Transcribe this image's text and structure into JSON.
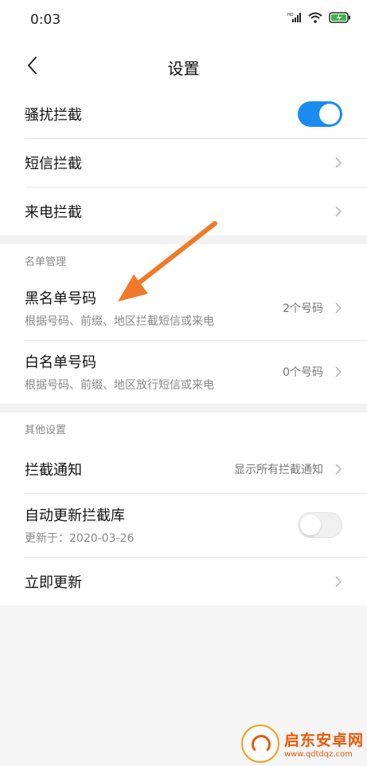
{
  "status_bar": {
    "time": "0:03"
  },
  "header": {
    "title": "设置"
  },
  "interception": {
    "items": [
      {
        "label": "骚扰拦截",
        "toggle": true
      },
      {
        "label": "短信拦截"
      },
      {
        "label": "来电拦截"
      }
    ]
  },
  "list_management": {
    "header": "名单管理",
    "items": [
      {
        "label": "黑名单号码",
        "sub": "根据号码、前缀、地区拦截短信或来电",
        "value": "2个号码"
      },
      {
        "label": "白名单号码",
        "sub": "根据号码、前缀、地区放行短信或来电",
        "value": "0个号码"
      }
    ]
  },
  "other_settings": {
    "header": "其他设置",
    "items": [
      {
        "label": "拦截通知",
        "value": "显示所有拦截通知"
      },
      {
        "label": "自动更新拦截库",
        "sub": "更新于：2020-03-26",
        "toggle": false
      },
      {
        "label": "立即更新"
      }
    ]
  },
  "watermark": {
    "title": "启东安卓网",
    "url": "www.qdtdqz.com"
  },
  "colors": {
    "accent": "#1a8cf0",
    "annotation_arrow": "#f07a2a"
  }
}
